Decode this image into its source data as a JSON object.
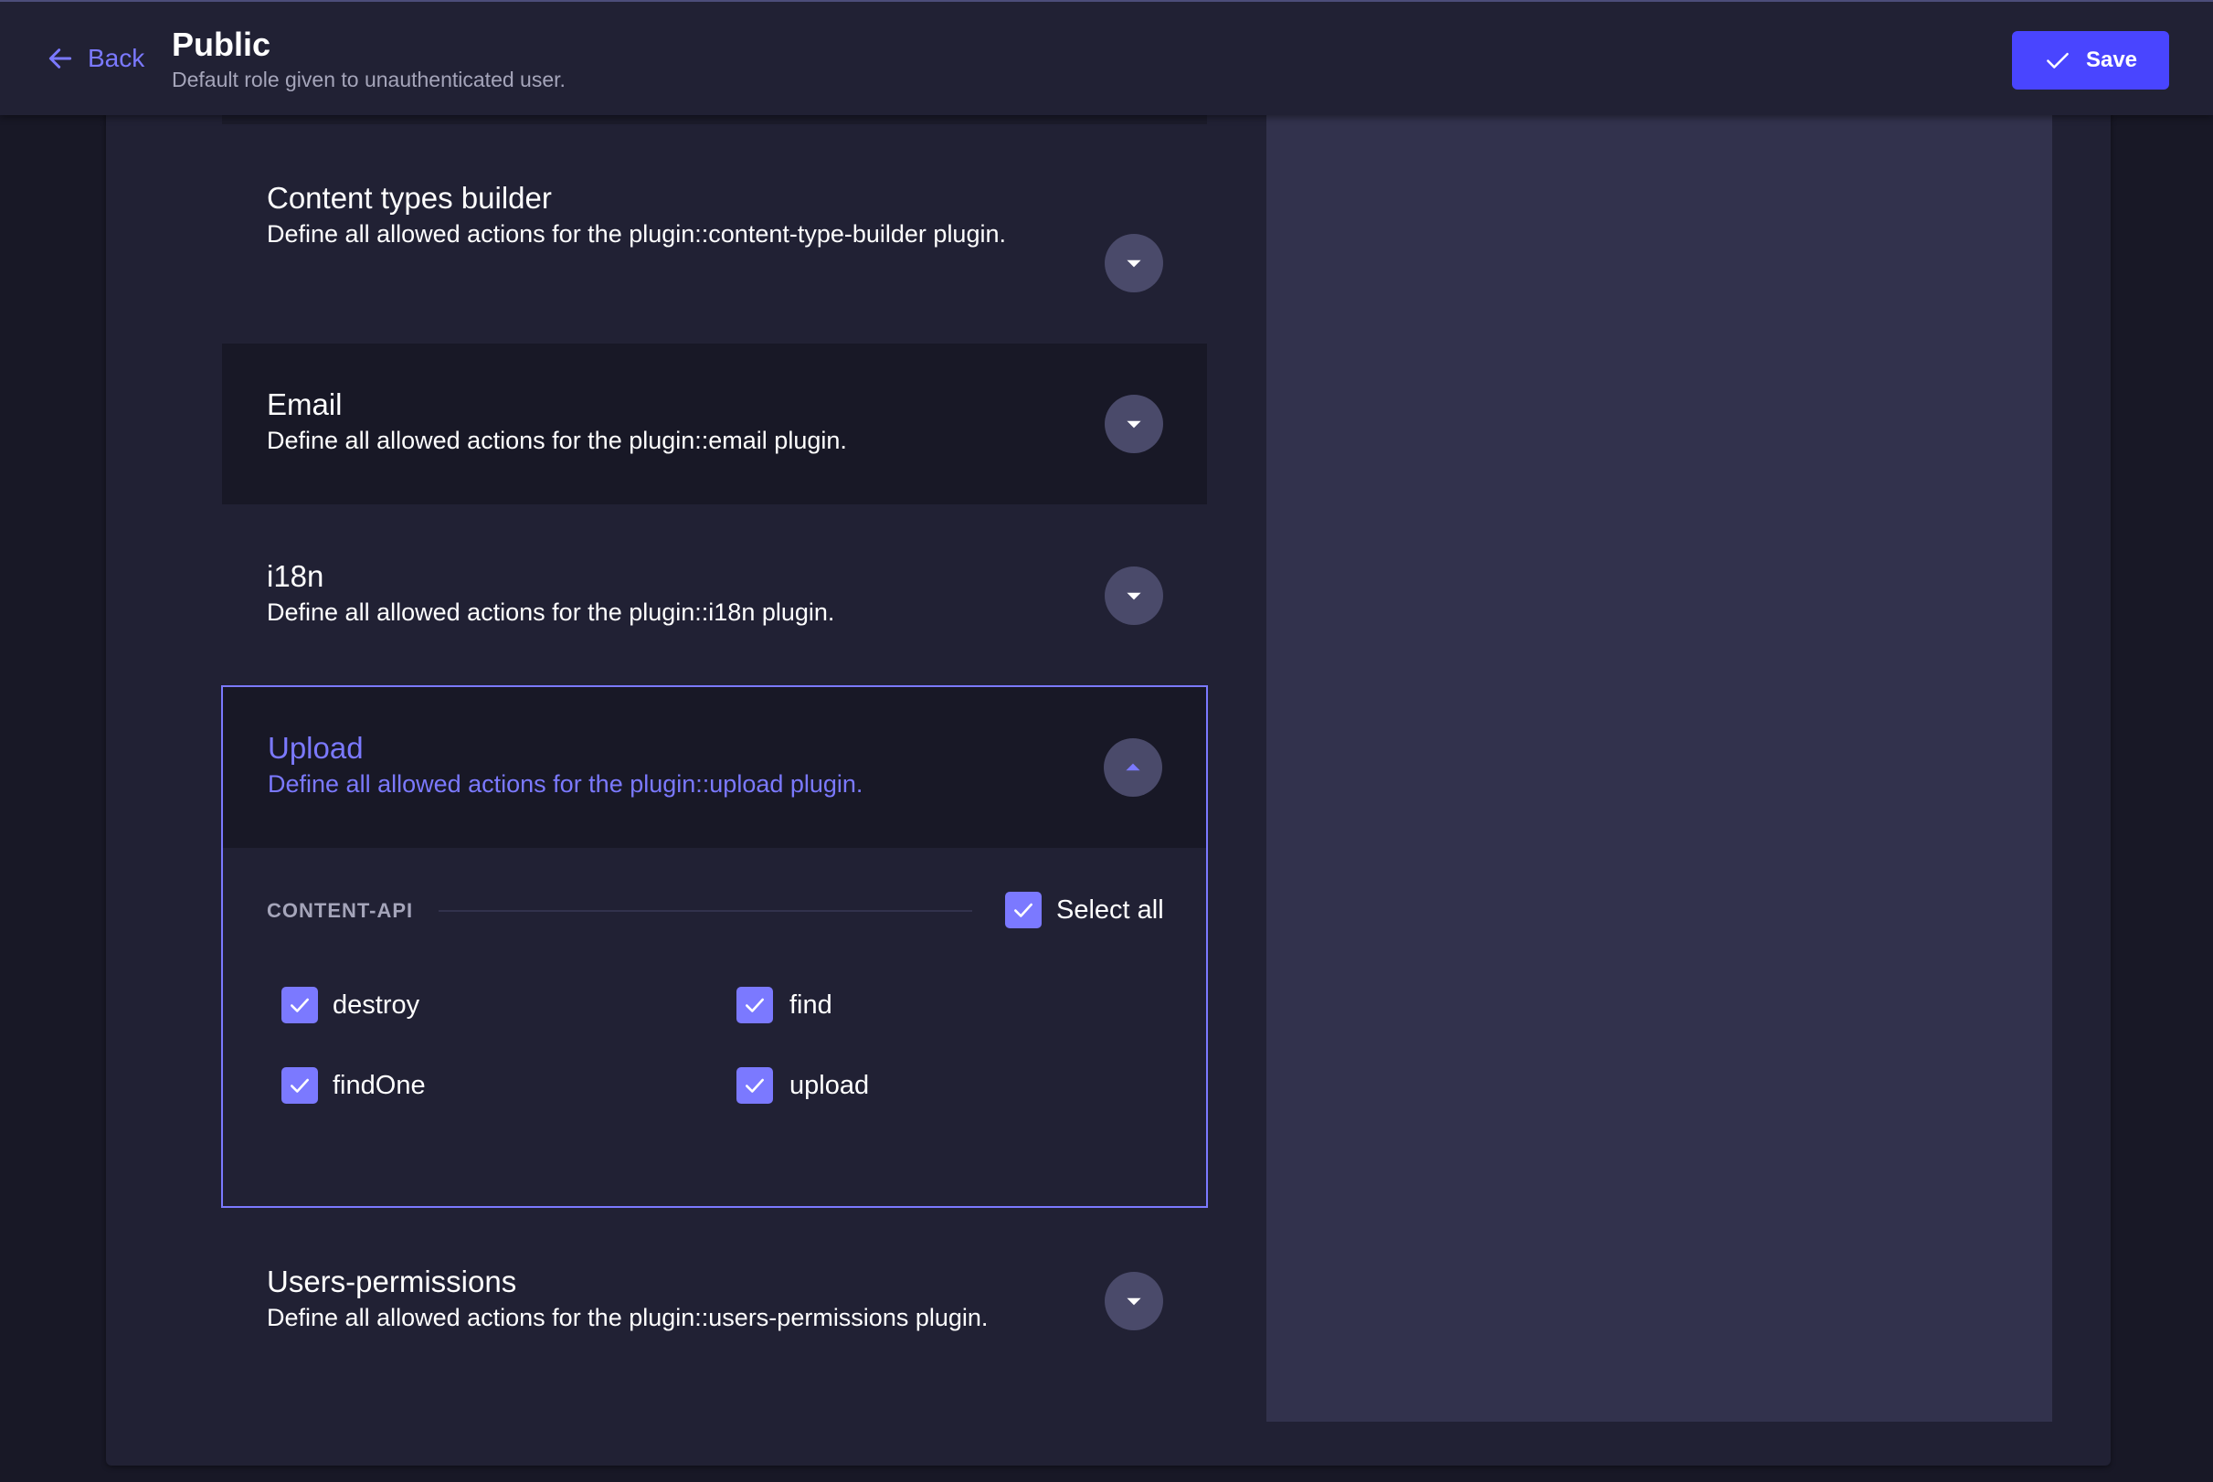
{
  "header": {
    "back_label": "Back",
    "title": "Public",
    "subtitle": "Default role given to unauthenticated user.",
    "save_label": "Save"
  },
  "accordions": [
    {
      "title": "Content types builder",
      "description": "Define all allowed actions for the plugin::content-type-builder plugin.",
      "expanded": false
    },
    {
      "title": "Email",
      "description": "Define all allowed actions for the plugin::email plugin.",
      "expanded": false
    },
    {
      "title": "i18n",
      "description": "Define all allowed actions for the plugin::i18n plugin.",
      "expanded": false
    },
    {
      "title": "Upload",
      "description": "Define all allowed actions for the plugin::upload plugin.",
      "expanded": true,
      "section": {
        "label": "CONTENT-API",
        "select_all_label": "Select all",
        "select_all_checked": true,
        "actions": [
          {
            "label": "destroy",
            "checked": true
          },
          {
            "label": "find",
            "checked": true
          },
          {
            "label": "findOne",
            "checked": true
          },
          {
            "label": "upload",
            "checked": true
          }
        ]
      }
    },
    {
      "title": "Users-permissions",
      "description": "Define all allowed actions for the plugin::users-permissions plugin.",
      "expanded": false
    }
  ],
  "colors": {
    "accent": "#7b79ff",
    "primary_button": "#4945ff",
    "background": "#181826",
    "surface": "#212134",
    "side_panel": "#32324d"
  }
}
